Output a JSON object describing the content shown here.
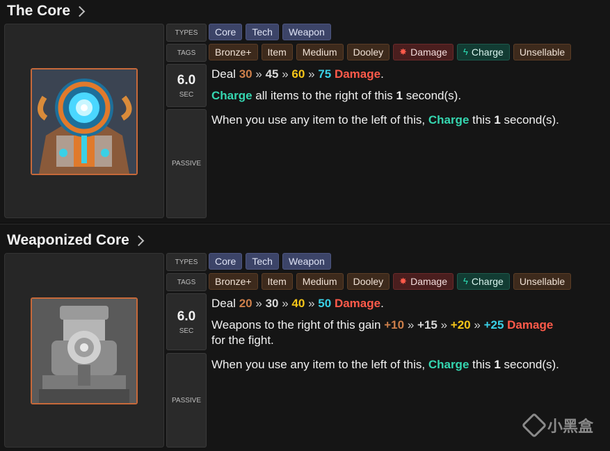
{
  "cards": [
    {
      "title": "The Core",
      "labels": {
        "types": "TYPES",
        "tags": "TAGS",
        "cooldown": "6.0",
        "unit": "SEC",
        "passive": "PASSIVE"
      },
      "types": [
        "Core",
        "Tech",
        "Weapon"
      ],
      "tags": {
        "tier": "Bronze+",
        "item": "Item",
        "size": "Medium",
        "hero": "Dooley",
        "damage": "Damage",
        "charge": "Charge",
        "sell": "Unsellable"
      },
      "line1": {
        "prefix": "Deal",
        "v1": "30",
        "s1": "»",
        "v2": "45",
        "s2": "»",
        "v3": "60",
        "s3": "»",
        "v4": "75",
        "word": "Damage",
        "suffix": "."
      },
      "line2": {
        "kw": "Charge",
        "text": " all items to the right of this ",
        "num": "1",
        "end": " second(s)."
      },
      "line3": {
        "text": "When you use any item to the left of this, ",
        "kw": "Charge",
        "mid": " this ",
        "num": "1",
        "end": " second(s)."
      }
    },
    {
      "title": "Weaponized Core",
      "labels": {
        "types": "TYPES",
        "tags": "TAGS",
        "cooldown": "6.0",
        "unit": "SEC",
        "passive": "PASSIVE"
      },
      "types": [
        "Core",
        "Tech",
        "Weapon"
      ],
      "tags": {
        "tier": "Bronze+",
        "item": "Item",
        "size": "Medium",
        "hero": "Dooley",
        "damage": "Damage",
        "charge": "Charge",
        "sell": "Unsellable"
      },
      "line1": {
        "prefix": "Deal",
        "v1": "20",
        "s1": "»",
        "v2": "30",
        "s2": "»",
        "v3": "40",
        "s3": "»",
        "v4": "50",
        "word": "Damage",
        "suffix": "."
      },
      "line2": {
        "text": "Weapons to the right of this gain ",
        "v1": "+10",
        "s1": "»",
        "v2": "+15",
        "s2": "»",
        "v3": "+20",
        "s3": "»",
        "v4": "+25",
        "word": "Damage",
        "end": "for the fight."
      },
      "line3": {
        "text": "When you use any item to the left of this, ",
        "kw": "Charge",
        "mid": " this ",
        "num": "1",
        "end": " second(s)."
      }
    }
  ],
  "watermark": "小黑盒",
  "colors": {
    "bronze": "#cd7f4a",
    "silver": "#d8d8d8",
    "gold": "#f5c518",
    "diamond": "#3ad0e6",
    "damage": "#ff5a4a",
    "charge": "#35d6b0"
  }
}
